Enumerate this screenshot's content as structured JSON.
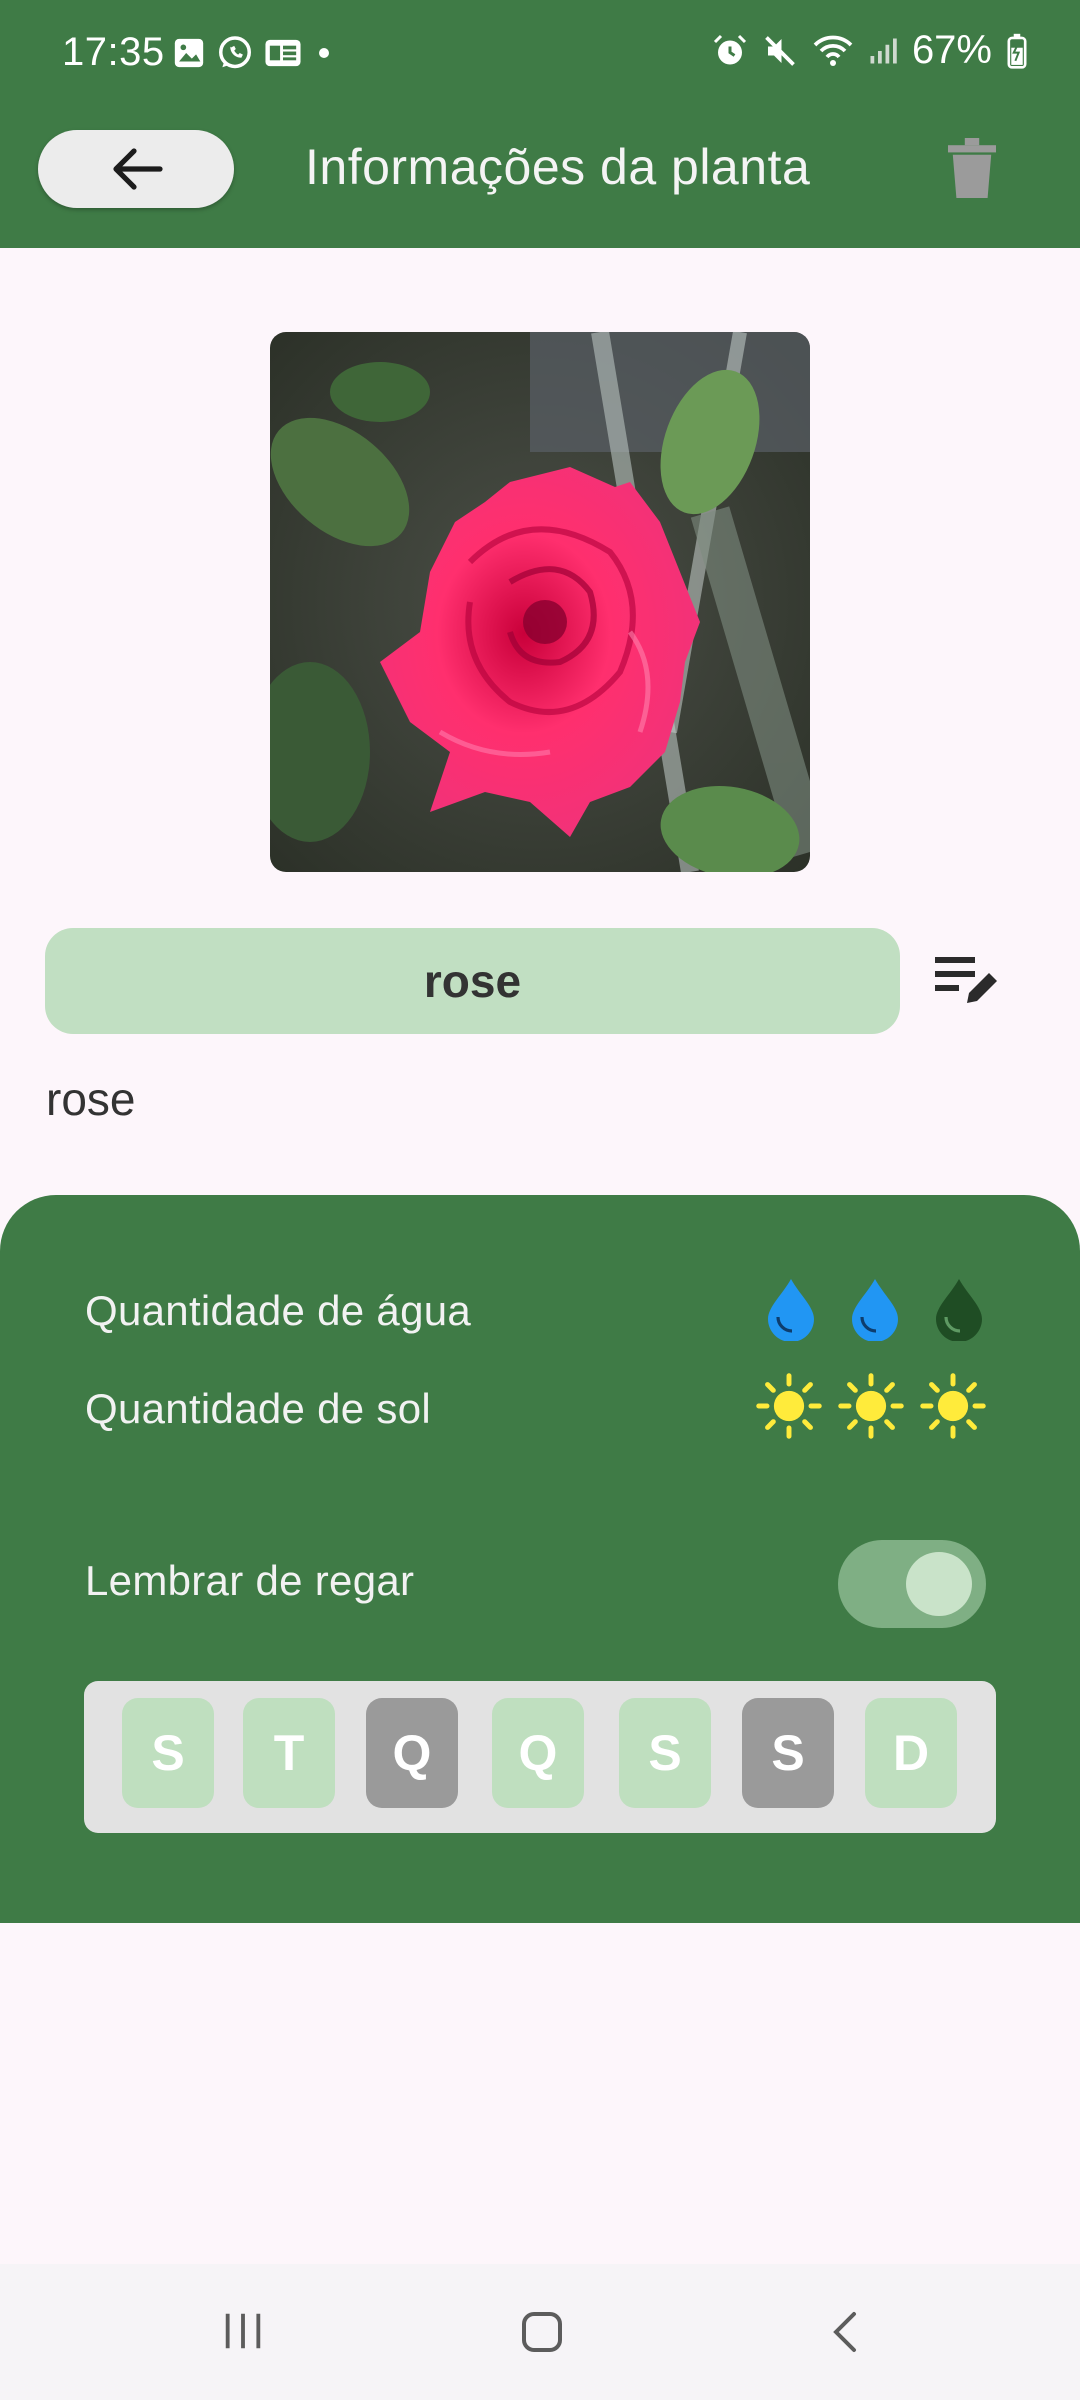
{
  "status_bar": {
    "time": "17:35",
    "battery": "67%"
  },
  "app_bar": {
    "title": "Informações da planta"
  },
  "plant": {
    "name": "rose",
    "subtitle": "rose"
  },
  "care": {
    "water_label": "Quantidade de água",
    "water_level": 2,
    "water_max": 3,
    "sun_label": "Quantidade de sol",
    "sun_level": 3,
    "sun_max": 3,
    "reminder_label": "Lembrar de regar",
    "reminder_on": true
  },
  "weekdays": [
    {
      "letter": "S",
      "active": true
    },
    {
      "letter": "T",
      "active": true
    },
    {
      "letter": "Q",
      "active": false
    },
    {
      "letter": "Q",
      "active": true
    },
    {
      "letter": "S",
      "active": true
    },
    {
      "letter": "S",
      "active": false
    },
    {
      "letter": "D",
      "active": true
    }
  ],
  "colors": {
    "primary_green": "#3f7b46",
    "water_active": "#2196f3",
    "water_inactive": "#1f4d24",
    "sun": "#ffeb3b",
    "day_active": "#bfdfbf",
    "day_inactive": "#9a9a9a"
  },
  "icons": [
    "back-arrow-icon",
    "trash-icon",
    "edit-list-icon",
    "water-drop-icon",
    "sun-icon",
    "recents-icon",
    "home-icon",
    "back-nav-icon"
  ]
}
